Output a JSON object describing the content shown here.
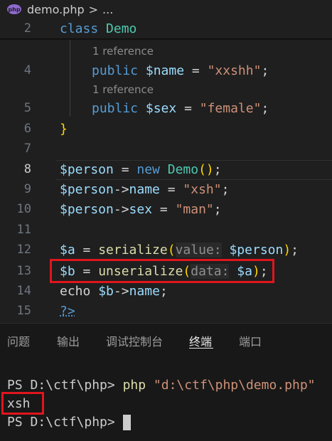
{
  "breadcrumb": {
    "file": "demo.php",
    "separator": ">",
    "rest": "..."
  },
  "editor": {
    "lines": {
      "l2": {
        "num": "2",
        "kw": "class",
        "cls": "Demo"
      },
      "lens4": "1 reference",
      "l4": {
        "num": "4",
        "kw": "public",
        "var": "$name",
        "eq": " = ",
        "str": "\"xxshh\"",
        "end": ";"
      },
      "lens5": "1 reference",
      "l5": {
        "num": "5",
        "kw": "public",
        "var": "$sex",
        "eq": " = ",
        "str": "\"female\"",
        "end": ";"
      },
      "l6": {
        "num": "6",
        "brace": "}"
      },
      "l7": {
        "num": "7"
      },
      "l8": {
        "num": "8",
        "var": "$person",
        "eq": " = ",
        "kw": "new",
        "cls": "Demo",
        "call": "()",
        "end": ";"
      },
      "l9": {
        "num": "9",
        "var": "$person",
        "arrow": "->",
        "prop": "name",
        "eq": " = ",
        "str": "\"xsh\"",
        "end": ";"
      },
      "l10": {
        "num": "10",
        "var": "$person",
        "arrow": "->",
        "prop": "sex",
        "eq": " = ",
        "str": "\"man\"",
        "end": ";"
      },
      "l11": {
        "num": "11"
      },
      "l12": {
        "num": "12",
        "var": "$a",
        "eq": " = ",
        "fn": "serialize",
        "open": "(",
        "hint": "value:",
        "arg": "$person",
        "close": ")",
        "end": ";"
      },
      "l13": {
        "num": "13",
        "var": "$b",
        "eq": " = ",
        "fn": "unserialize",
        "open": "(",
        "hint": "data:",
        "arg": "$a",
        "close": ")",
        "end": ";"
      },
      "l14": {
        "num": "14",
        "kw": "echo",
        "var": "$b",
        "arrow": "->",
        "prop": "name",
        "end": ";"
      },
      "l15": {
        "num": "15",
        "tag": "?>"
      }
    }
  },
  "panel": {
    "tabs": [
      "问题",
      "输出",
      "调试控制台",
      "终端",
      "端口"
    ],
    "active_tab": "终端",
    "terminal": {
      "prompt1": "PS D:\\ctf\\php> ",
      "cmd": "php",
      "arg": "\"d:\\ctf\\php\\demo.php\"",
      "output": "xsh",
      "prompt2": "PS D:\\ctf\\php> "
    }
  },
  "colors": {
    "highlight_border": "#e0151d",
    "background": "#1f1f1f"
  }
}
